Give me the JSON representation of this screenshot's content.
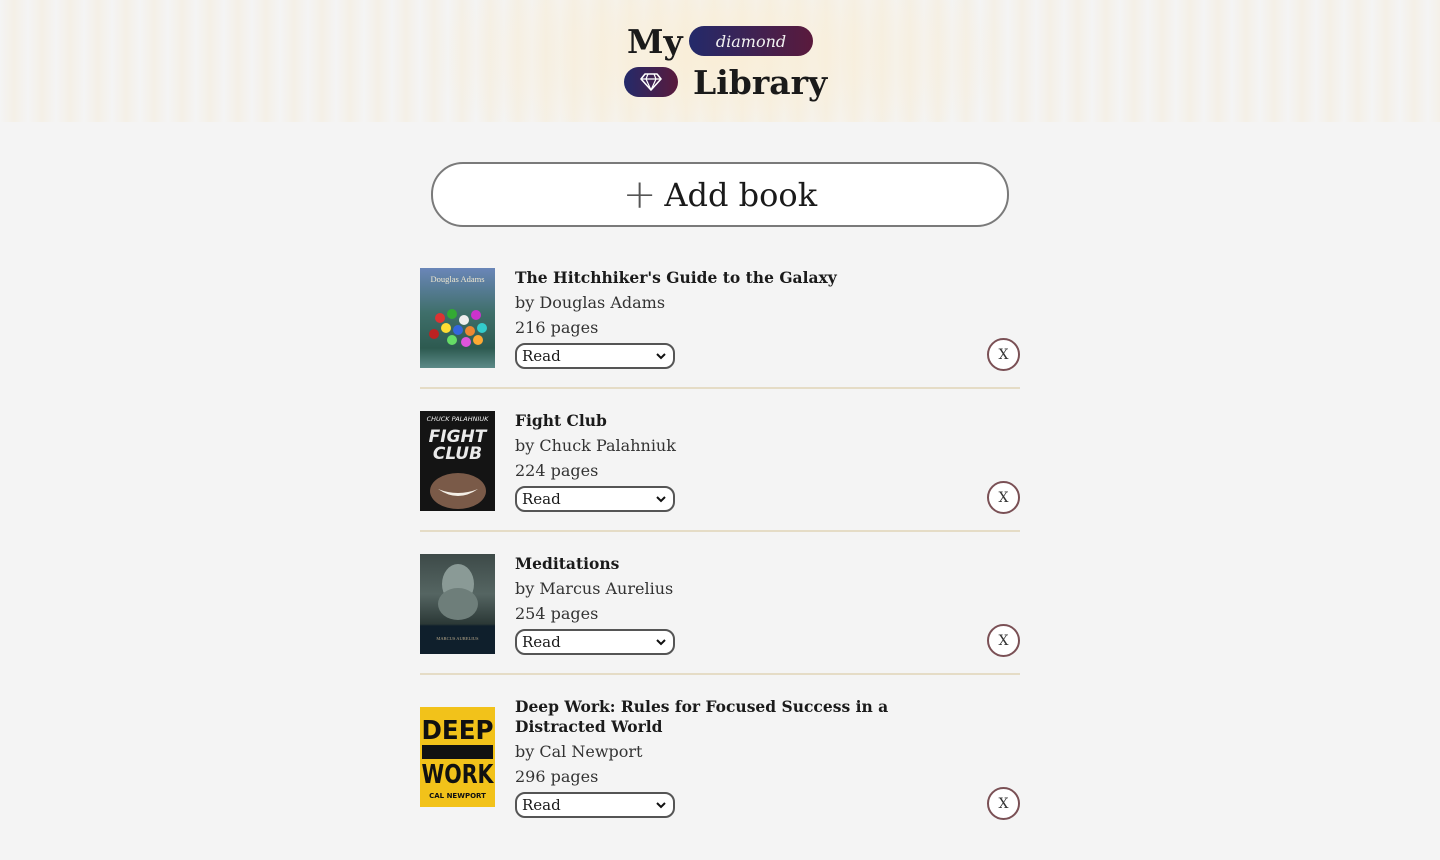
{
  "header": {
    "title_line1": "My",
    "title_line2": "Library",
    "tier_badge": "diamond",
    "gem_icon": "diamond-icon"
  },
  "add_book": {
    "label": "Add book",
    "icon": "plus-icon"
  },
  "books": [
    {
      "title": "The Hitchhiker's Guide to the Galaxy",
      "author": "by Douglas Adams",
      "pages": "216 pages",
      "status": "Read",
      "remove_label": "X",
      "cover": {
        "line1": "Douglas Adams",
        "line2": "THE HITCHHIKER'S GUIDE TO THE GALAXY"
      }
    },
    {
      "title": "Fight Club",
      "author": "by Chuck Palahniuk",
      "pages": "224 pages",
      "status": "Read",
      "remove_label": "X",
      "cover": {
        "line1": "CHUCK PALAHNIUK",
        "line2": "FIGHT",
        "line3": "CLUB"
      }
    },
    {
      "title": "Meditations",
      "author": "by Marcus Aurelius",
      "pages": "254 pages",
      "status": "Read",
      "remove_label": "X",
      "cover": {
        "line1": "MARCUS AURELIUS"
      }
    },
    {
      "title": "Deep Work: Rules for Focused Success in a Distracted World",
      "author": "by Cal Newport",
      "pages": "296 pages",
      "status": "Read",
      "remove_label": "X",
      "cover": {
        "line1": "DEEP",
        "line2": "WORK",
        "line3": "CAL NEWPORT"
      }
    }
  ],
  "status_options_visible": [
    "Read"
  ]
}
